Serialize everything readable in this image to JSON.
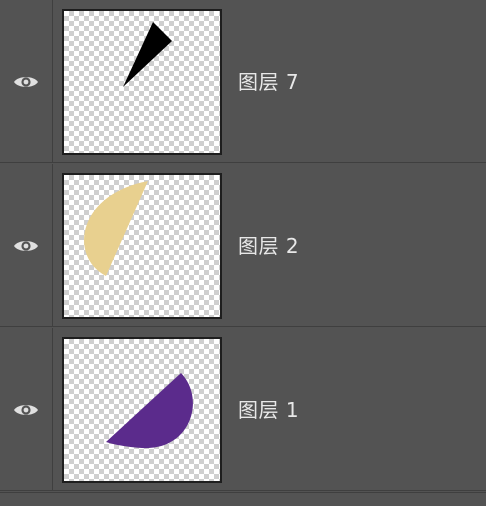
{
  "panel": "layers",
  "layers": [
    {
      "name": "图层 7",
      "visible": true,
      "thumbnail": {
        "shape": "black-wedge",
        "color": "#000000"
      }
    },
    {
      "name": "图层 2",
      "visible": true,
      "thumbnail": {
        "shape": "tan-half-disc",
        "color": "#e8d08f"
      }
    },
    {
      "name": "图层 1",
      "visible": true,
      "thumbnail": {
        "shape": "purple-half-disc",
        "color": "#5b2b8c"
      }
    }
  ],
  "icons": {
    "visibility": "eye-icon"
  }
}
